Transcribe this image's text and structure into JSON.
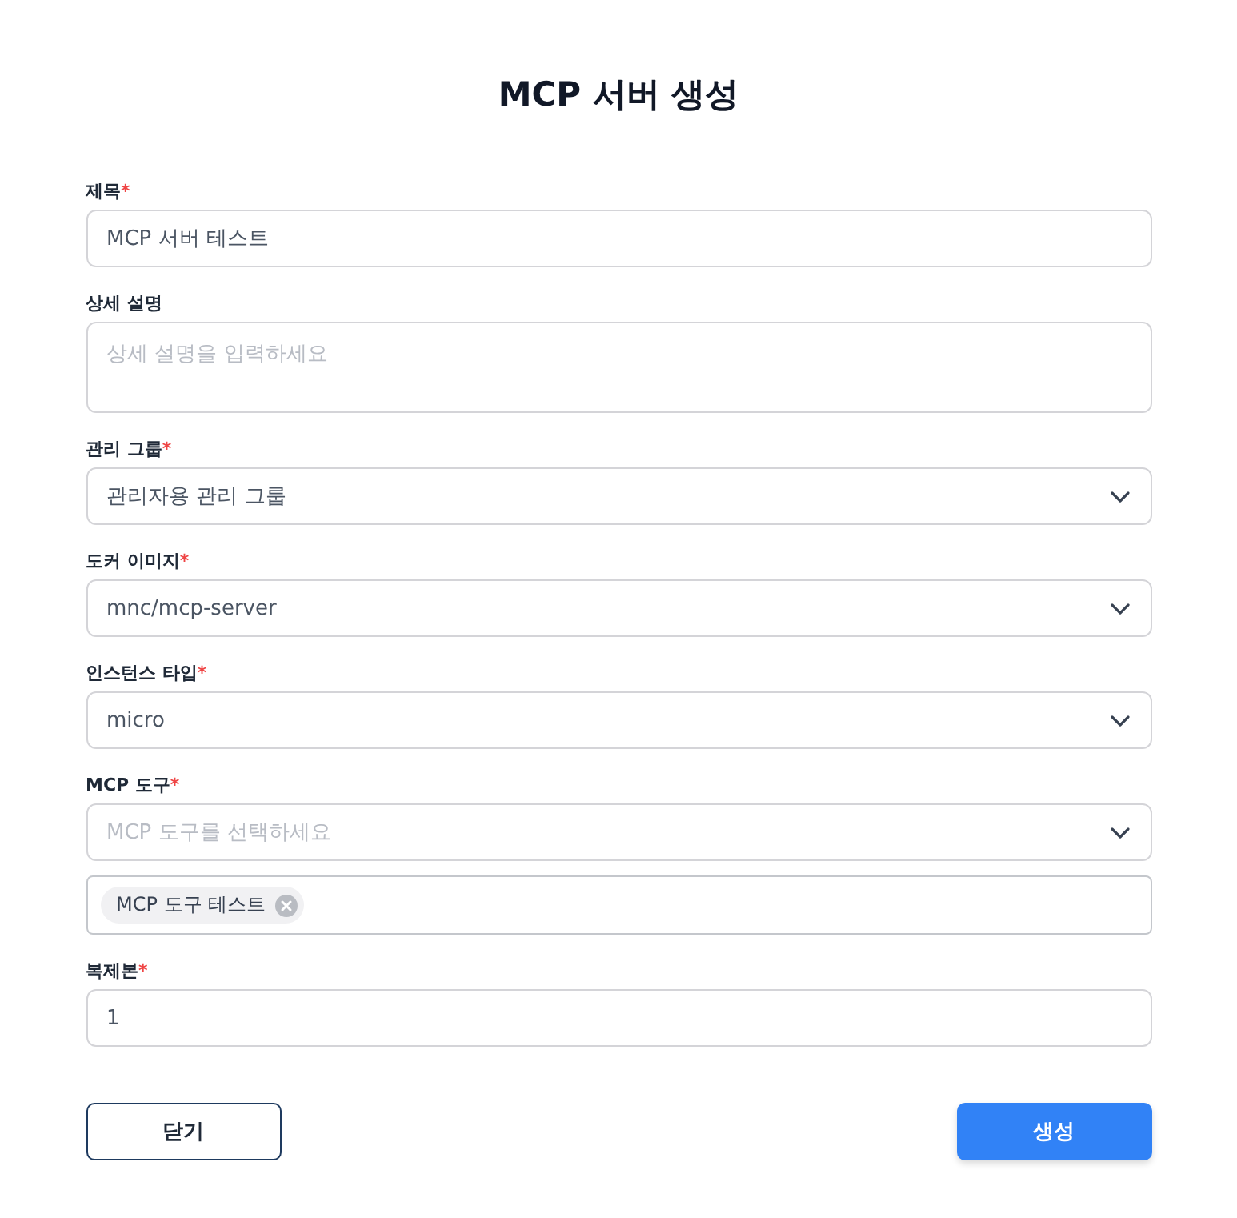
{
  "title": "MCP 서버 생성",
  "fields": [
    {
      "kind": "text",
      "label": "제목",
      "required_mark": "*",
      "value": "MCP 서버 테스트"
    },
    {
      "kind": "textarea",
      "label": "상세 설명",
      "placeholder": "상세 설명을 입력하세요"
    },
    {
      "kind": "select",
      "label": "관리 그룹",
      "required_mark": "*",
      "value": "관리자용 관리 그룹"
    },
    {
      "kind": "select",
      "label": "도커 이미지",
      "required_mark": "*",
      "value": "mnc/mcp-server"
    },
    {
      "kind": "select",
      "label": "인스턴스 타입",
      "required_mark": "*",
      "value": "micro"
    },
    {
      "kind": "multiselect",
      "label": "MCP 도구",
      "required_mark": "*",
      "placeholder": "MCP 도구를 선택하세요",
      "tags": [
        "MCP 도구 테스트"
      ]
    },
    {
      "kind": "text",
      "label": "복제본",
      "required_mark": "*",
      "value": "1"
    }
  ],
  "buttons": [
    {
      "kind": "secondary",
      "label": "닫기"
    },
    {
      "kind": "primary",
      "label": "생성"
    }
  ]
}
